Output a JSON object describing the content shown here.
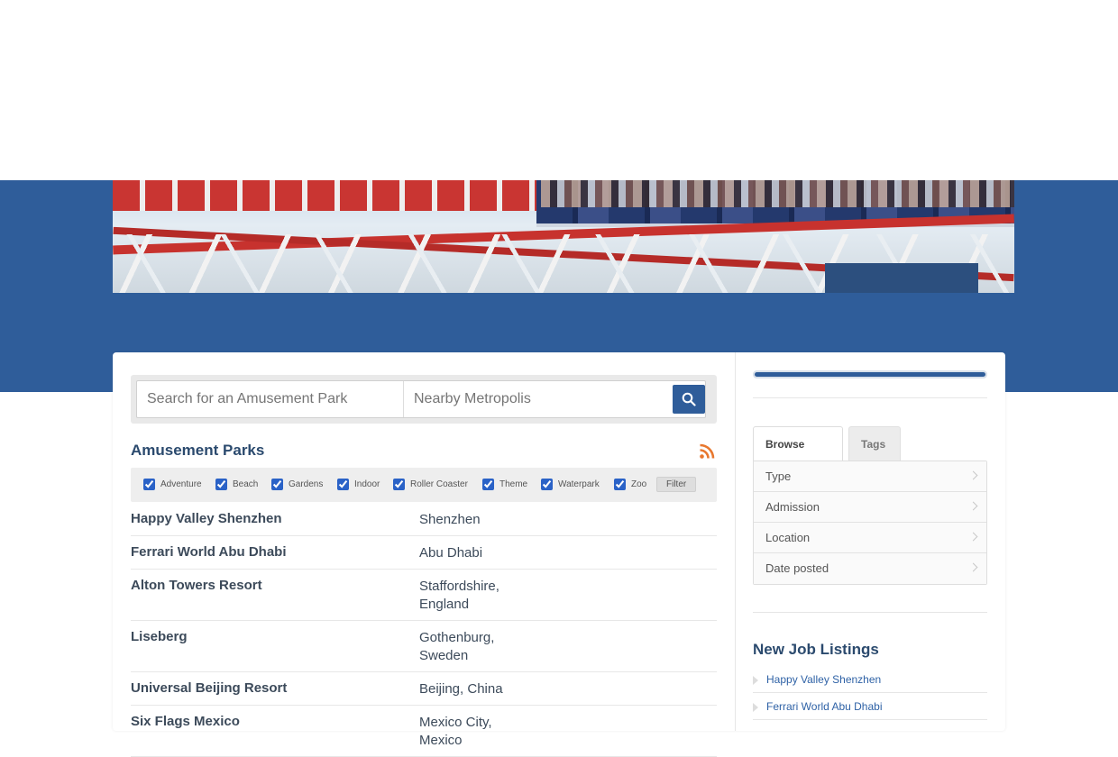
{
  "search": {
    "park_placeholder": "Search for an Amusement Park",
    "location_placeholder": "Nearby Metropolis"
  },
  "list": {
    "title": "Amusement Parks",
    "filters": [
      "Adventure",
      "Beach",
      "Gardens",
      "Indoor",
      "Roller Coaster",
      "Theme",
      "Waterpark",
      "Zoo"
    ],
    "filter_button": "Filter",
    "parks": [
      {
        "name": "Happy Valley Shenzhen",
        "location": "Shenzhen"
      },
      {
        "name": "Ferrari World Abu Dhabi",
        "location": "Abu Dhabi"
      },
      {
        "name": "Alton Towers Resort",
        "location": "Staffordshire, England"
      },
      {
        "name": "Liseberg",
        "location": "Gothenburg, Sweden"
      },
      {
        "name": "Universal Beijing Resort",
        "location": "Beijing, China"
      },
      {
        "name": "Six Flags Mexico",
        "location": "Mexico City, Mexico"
      }
    ]
  },
  "sidebar": {
    "progress": 1.0,
    "tabs": {
      "browse": "Browse by…",
      "tags": "Tags"
    },
    "browse_items": [
      "Type",
      "Admission",
      "Location",
      "Date posted"
    ],
    "jobs_title": "New Job Listings",
    "jobs": [
      "Happy Valley Shenzhen",
      "Ferrari World Abu Dhabi"
    ]
  },
  "colors": {
    "brand_blue": "#2f5d9a",
    "link_blue": "#2f62a6",
    "rss_orange": "#e8772e"
  }
}
